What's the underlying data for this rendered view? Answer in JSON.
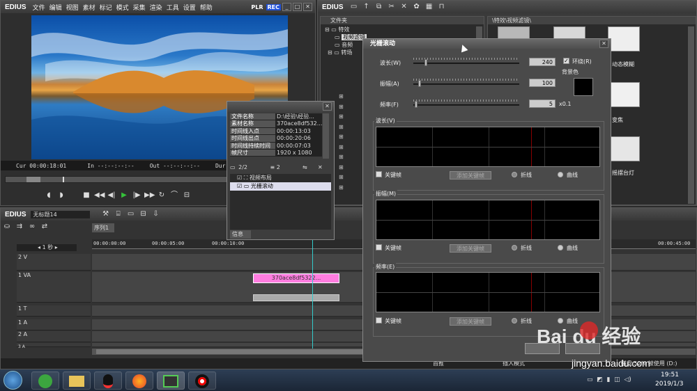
{
  "app": {
    "logo": "EDIUS",
    "menu": [
      "文件",
      "编辑",
      "视图",
      "素材",
      "标记",
      "模式",
      "采集",
      "渲染",
      "工具",
      "设置",
      "帮助"
    ],
    "plr": "PLR",
    "rec": "REC"
  },
  "player": {
    "cur": "Cur 00:00:18:01",
    "in": "In --:--:--:--",
    "out": "Out --:--:--:--",
    "dur": "Dur --:--:--:--"
  },
  "bin": {
    "logo": "EDIUS",
    "folder_header": "文件夹",
    "tree": [
      "特效",
      "视频滤镜",
      "音频",
      "转场"
    ],
    "path": "\\特效\\视频滤镜\\",
    "thumb_labels": [
      "动态模糊",
      "变焦",
      "摇摆台灯"
    ]
  },
  "info_panel": {
    "rows": [
      {
        "k": "文件名称",
        "v": "D:\\经验\\经验..."
      },
      {
        "k": "素材名称",
        "v": "370ace8df532..."
      },
      {
        "k": "时间线入点",
        "v": "00:00:13:03"
      },
      {
        "k": "时间线出点",
        "v": "00:00:20:06"
      },
      {
        "k": "时间线持续时间",
        "v": "00:00:07:03"
      },
      {
        "k": "帧尺寸",
        "v": "1920 x 1080"
      }
    ],
    "count_a": "2/2",
    "count_b": "2",
    "effects": [
      "视频布局",
      "光栅滚动"
    ],
    "tab": "信息"
  },
  "timeline": {
    "logo": "EDIUS",
    "project": "无标题14",
    "sequence_tab": "序列1",
    "scale": "1 秒",
    "ruler": [
      "00:00:00:00",
      "00:00:05:00",
      "00:00:10:00",
      "00:00:45:00"
    ],
    "tracks": [
      "2 V",
      "1 VA",
      "1 T",
      "1 A",
      "2 A",
      "3 A"
    ],
    "clip_label": "370ace8df5322...",
    "seq_label": "序列标",
    "status": "磁盘 52% 被使用 (D:)",
    "status_left": "首推",
    "status_mid": "插入模式"
  },
  "dialog": {
    "title": "光栅滚动",
    "wavelength_label": "波长(W)",
    "wavelength_value": "240",
    "amplitude_label": "振幅(A)",
    "amplitude_value": "100",
    "frequency_label": "频率(F)",
    "frequency_value": "5",
    "frequency_unit": "x0.1",
    "loop_label": "环绕(R)",
    "bg_color_label": "背景色",
    "groups": [
      "波长(V)",
      "振幅(M)",
      "频率(E)"
    ],
    "keyframe_label": "关键帧",
    "add_keyframe": "添加关键帧",
    "polyline": "折线",
    "curve": "曲线"
  },
  "taskbar": {
    "time": "19:51",
    "date": "2019/1/3"
  },
  "watermark": {
    "brand": "Bai du 经验",
    "url": "jingyan.baidu.com"
  },
  "colors": {
    "rec": "#1f4fd6",
    "clip": "#ff7de0",
    "accent_green": "#35c23a"
  }
}
